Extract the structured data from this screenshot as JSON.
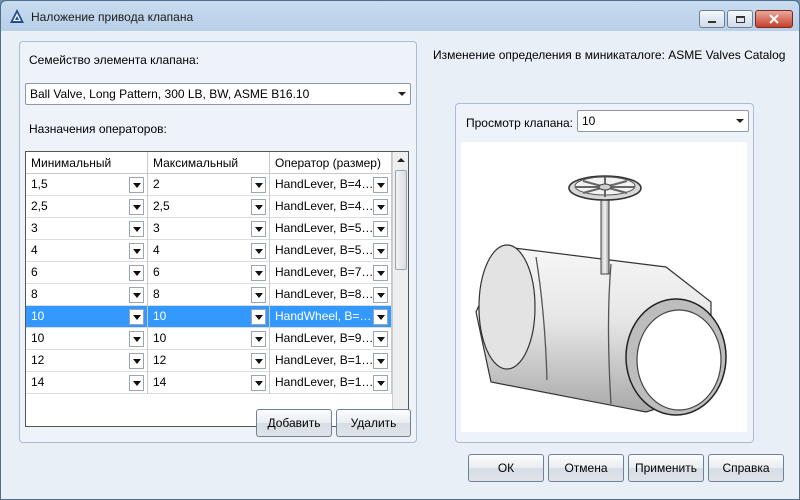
{
  "window": {
    "title": "Наложение привода клапана",
    "buttons": {
      "minimize": "minimize",
      "maximize": "maximize",
      "close": "close"
    }
  },
  "left": {
    "family_label": "Семейство элемента клапана:",
    "family_value": "Ball Valve, Long Pattern, 300 LB, BW, ASME B16.10",
    "operators_label": "Назначения операторов:",
    "columns": [
      "Минимальный",
      "Максимальный",
      "Оператор (размер)"
    ],
    "rows": [
      {
        "min": "1,5",
        "max": "2",
        "op": "HandLever, B=4…",
        "selected": false
      },
      {
        "min": "2,5",
        "max": "2,5",
        "op": "HandLever, B=4…",
        "selected": false
      },
      {
        "min": "3",
        "max": "3",
        "op": "HandLever, B=5…",
        "selected": false
      },
      {
        "min": "4",
        "max": "4",
        "op": "HandLever, B=5…",
        "selected": false
      },
      {
        "min": "6",
        "max": "6",
        "op": "HandLever, B=7…",
        "selected": false
      },
      {
        "min": "8",
        "max": "8",
        "op": "HandLever, B=8…",
        "selected": false
      },
      {
        "min": "10",
        "max": "10",
        "op": "HandWheel, B=…",
        "selected": true
      },
      {
        "min": "10",
        "max": "10",
        "op": "HandLever, B=9…",
        "selected": false
      },
      {
        "min": "12",
        "max": "12",
        "op": "HandLever, B=1…",
        "selected": false
      },
      {
        "min": "14",
        "max": "14",
        "op": "HandLever, B=1…",
        "selected": false
      }
    ],
    "add_button": "Добавить",
    "delete_button": "Удалить"
  },
  "right": {
    "catalog_label": "Изменение определения в миникаталоге: ASME Valves Catalog",
    "preview_label": "Просмотр клапана:",
    "preview_value": "10"
  },
  "footer": {
    "ok": "ОК",
    "cancel": "Отмена",
    "apply": "Применить",
    "help": "Справка"
  },
  "colors": {
    "selection": "#3399ff",
    "dialog_bg": "#e9eff6"
  }
}
